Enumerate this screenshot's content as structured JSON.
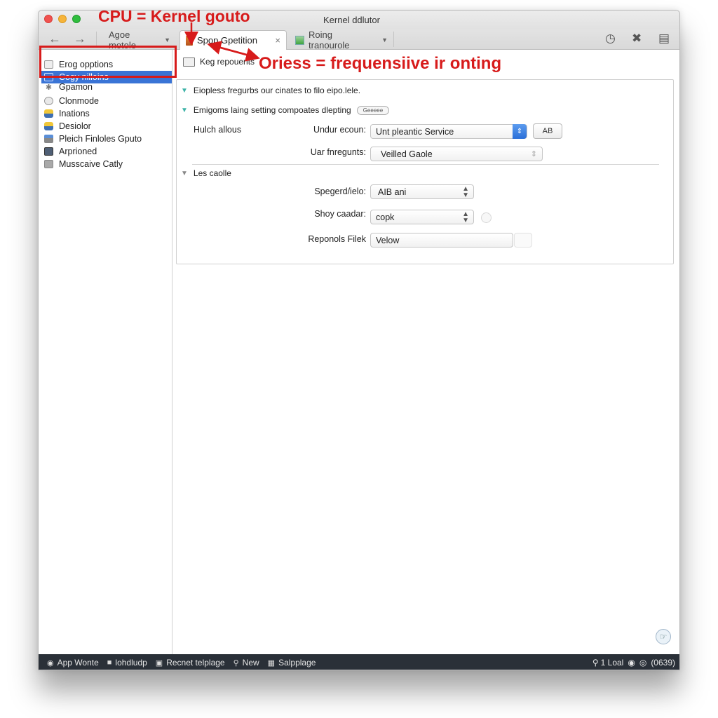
{
  "window": {
    "title": "Kernel ddlutor"
  },
  "toolbar": {
    "back_icon": "arrow-left-icon",
    "forward_icon": "arrow-right-icon",
    "tabs": [
      {
        "label": "Agoe motole",
        "has_dropdown": true
      },
      {
        "label": "Spop Gpetition",
        "active": true,
        "closable": true
      },
      {
        "label": "Roing tranourole",
        "has_dropdown": true
      }
    ],
    "right_icons": [
      "clock-download-icon",
      "tools-icon",
      "sidebar-panel-icon"
    ]
  },
  "sidebar": {
    "items": [
      {
        "label": "Erog opptions",
        "icon": "box-icon",
        "selected": false
      },
      {
        "label": "Cogy nilloins",
        "icon": "settings-icon",
        "selected": true
      },
      {
        "label": "Gpamon",
        "icon": "star-icon",
        "selected": false
      },
      {
        "label": "Clonmode",
        "icon": "circle-icon",
        "selected": false
      },
      {
        "label": "Inations",
        "icon": "person-icon",
        "selected": false
      },
      {
        "label": "Desiolor",
        "icon": "pin-icon",
        "selected": false
      },
      {
        "label": "Pleich Finloles Gputo",
        "icon": "stand-icon",
        "selected": false
      },
      {
        "label": "Arprioned",
        "icon": "monitor-icon",
        "selected": false
      },
      {
        "label": "Musscaive Catly",
        "icon": "calendar-icon",
        "selected": false
      }
    ]
  },
  "annotations": {
    "top": "CPU = Kernel gouto",
    "middle": "Oriess = frequensiive ir onting",
    "color": "#d71b1b"
  },
  "content": {
    "header": "Keg repouents",
    "sections": [
      {
        "label": "Eiopless fregurbs our cinates to filo eipo.lele.",
        "expanded": true
      },
      {
        "label": "Emigoms laing setting compoates dlepting",
        "expanded": true,
        "badge": "Geeeee"
      }
    ],
    "group1": {
      "title": "Hulch allous",
      "fields": [
        {
          "label": "Undur ecoun:",
          "value": "Unt pleantic Service",
          "button": "AB"
        },
        {
          "label": "Uar fnregunts:",
          "value": "Veilled Gaole"
        }
      ]
    },
    "group2": {
      "title": "Les caolle",
      "fields": [
        {
          "label": "Spegerd/ielo:",
          "value": "AIB ani"
        },
        {
          "label": "Shoy caadar:",
          "value": "copk"
        },
        {
          "label": "Reponols Filek",
          "value": "Velow"
        }
      ]
    }
  },
  "statusbar": {
    "left": [
      {
        "label": "App Wonte",
        "icon": "lock-icon"
      },
      {
        "label": "lohdludp",
        "icon": "cup-icon"
      },
      {
        "label": "Recnet telplage",
        "icon": "stack-icon"
      },
      {
        "label": "New",
        "icon": "pin-icon"
      },
      {
        "label": "Salpplage",
        "icon": "grid-icon"
      }
    ],
    "right": {
      "search_label": "1 Loal",
      "count": "(0639)"
    }
  },
  "colors": {
    "selection": "#3a74d6",
    "statusbar_bg": "#2a3038",
    "annotation": "#d71b1b",
    "disclosure_teal": "#3eb3a8"
  }
}
